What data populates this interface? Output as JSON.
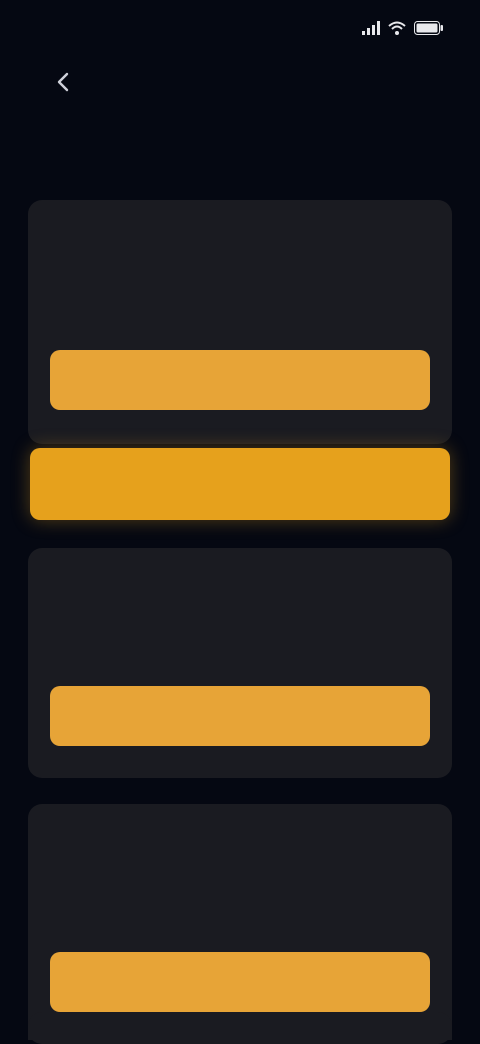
{
  "status_bar": {
    "time": "",
    "icons": [
      "signal-icon",
      "wifi-icon",
      "battery-icon"
    ]
  },
  "header": {
    "back_icon": "arrow-left-icon",
    "title": ""
  },
  "plans": [
    {
      "name": "",
      "tag": "",
      "description": "",
      "price": "",
      "unit": "",
      "button_label": ""
    },
    {
      "name": "",
      "tag": "",
      "description": "",
      "price": "",
      "unit": "",
      "button_label": ""
    },
    {
      "name": "",
      "tag": "",
      "description": "",
      "price": "",
      "unit": "",
      "button_label": ""
    }
  ],
  "recommended_banner": {
    "label": ""
  },
  "colors": {
    "background": "#050812",
    "card": "#1a1b21",
    "accent": "#e7a437",
    "banner": "#e6a11c"
  }
}
